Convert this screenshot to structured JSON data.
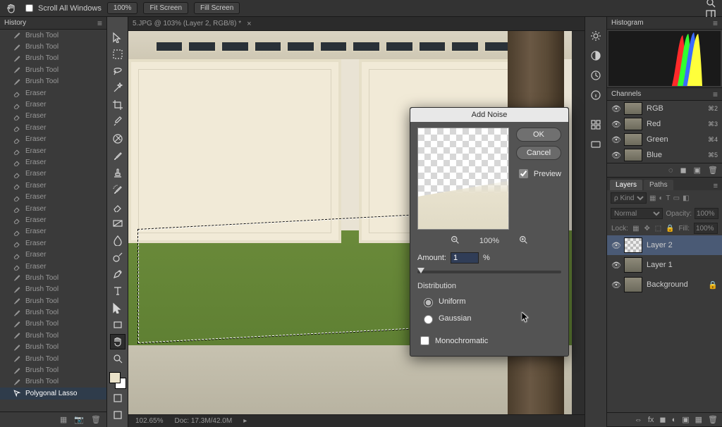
{
  "options_bar": {
    "scroll_all": "Scroll All Windows",
    "zoom": "100%",
    "fit": "Fit Screen",
    "fill": "Fill Screen"
  },
  "document": {
    "tab_title": "5.JPG @ 103% (Layer 2, RGB/8) *",
    "zoom_status": "102.65%",
    "doc_status": "Doc: 17.3M/42.0M"
  },
  "history": {
    "title": "History",
    "items": [
      {
        "label": "Brush Tool",
        "icon": "brush"
      },
      {
        "label": "Brush Tool",
        "icon": "brush"
      },
      {
        "label": "Brush Tool",
        "icon": "brush"
      },
      {
        "label": "Brush Tool",
        "icon": "brush"
      },
      {
        "label": "Brush Tool",
        "icon": "brush"
      },
      {
        "label": "Eraser",
        "icon": "eraser"
      },
      {
        "label": "Eraser",
        "icon": "eraser"
      },
      {
        "label": "Eraser",
        "icon": "eraser"
      },
      {
        "label": "Eraser",
        "icon": "eraser"
      },
      {
        "label": "Eraser",
        "icon": "eraser"
      },
      {
        "label": "Eraser",
        "icon": "eraser"
      },
      {
        "label": "Eraser",
        "icon": "eraser"
      },
      {
        "label": "Eraser",
        "icon": "eraser"
      },
      {
        "label": "Eraser",
        "icon": "eraser"
      },
      {
        "label": "Eraser",
        "icon": "eraser"
      },
      {
        "label": "Eraser",
        "icon": "eraser"
      },
      {
        "label": "Eraser",
        "icon": "eraser"
      },
      {
        "label": "Eraser",
        "icon": "eraser"
      },
      {
        "label": "Eraser",
        "icon": "eraser"
      },
      {
        "label": "Eraser",
        "icon": "eraser"
      },
      {
        "label": "Eraser",
        "icon": "eraser"
      },
      {
        "label": "Brush Tool",
        "icon": "brush"
      },
      {
        "label": "Brush Tool",
        "icon": "brush"
      },
      {
        "label": "Brush Tool",
        "icon": "brush"
      },
      {
        "label": "Brush Tool",
        "icon": "brush"
      },
      {
        "label": "Brush Tool",
        "icon": "brush"
      },
      {
        "label": "Brush Tool",
        "icon": "brush"
      },
      {
        "label": "Brush Tool",
        "icon": "brush"
      },
      {
        "label": "Brush Tool",
        "icon": "brush"
      },
      {
        "label": "Brush Tool",
        "icon": "brush"
      },
      {
        "label": "Brush Tool",
        "icon": "brush"
      },
      {
        "label": "Polygonal Lasso",
        "icon": "lasso",
        "selected": true
      }
    ]
  },
  "tools": [
    "move",
    "marquee",
    "lasso",
    "wand",
    "crop",
    "eyedropper",
    "healing",
    "brush",
    "stamp",
    "history-brush",
    "eraser",
    "gradient",
    "blur",
    "dodge",
    "pen",
    "type",
    "path-select",
    "rectangle",
    "hand",
    "zoom"
  ],
  "dialog": {
    "title": "Add Noise",
    "ok": "OK",
    "cancel": "Cancel",
    "preview": "Preview",
    "preview_zoom": "100%",
    "amount_label": "Amount:",
    "amount_value": "1",
    "amount_suffix": "%",
    "dist_label": "Distribution",
    "dist_uniform": "Uniform",
    "dist_gaussian": "Gaussian",
    "mono": "Monochromatic"
  },
  "right": {
    "histogram": "Histogram",
    "channels": "Channels",
    "channel_list": [
      {
        "name": "RGB",
        "shortcut": "⌘2"
      },
      {
        "name": "Red",
        "shortcut": "⌘3"
      },
      {
        "name": "Green",
        "shortcut": "⌘4"
      },
      {
        "name": "Blue",
        "shortcut": "⌘5"
      }
    ],
    "layers_tab": "Layers",
    "paths_tab": "Paths",
    "kind_placeholder": "Kind",
    "blend_mode": "Normal",
    "opacity_label": "Opacity:",
    "opacity_value": "100%",
    "lock_label": "Lock:",
    "fill_label": "Fill:",
    "fill_value": "100%",
    "layers": [
      {
        "name": "Layer 2",
        "thumb": "checker",
        "selected": true
      },
      {
        "name": "Layer 1",
        "thumb": "img"
      },
      {
        "name": "Background",
        "thumb": "img",
        "locked": true
      }
    ]
  }
}
